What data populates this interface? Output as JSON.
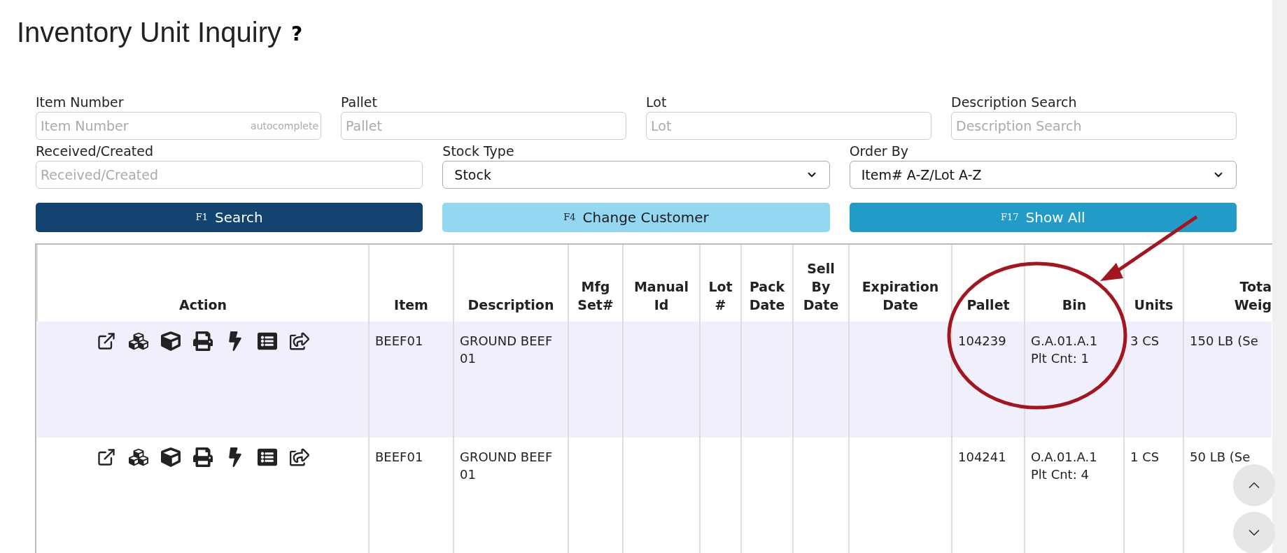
{
  "page": {
    "title": "Inventory Unit Inquiry",
    "help": "?"
  },
  "filter_rows": [
    [
      {
        "kind": "text",
        "label": "Item Number",
        "placeholder": "Item Number",
        "hint": "autocomplete"
      },
      {
        "kind": "text",
        "label": "Pallet",
        "placeholder": "Pallet"
      },
      {
        "kind": "text",
        "label": "Lot",
        "placeholder": "Lot"
      },
      {
        "kind": "text",
        "label": "Description Search",
        "placeholder": "Description Search"
      }
    ],
    [
      {
        "kind": "text",
        "label": "Received/Created",
        "placeholder": "Received/Created"
      },
      {
        "kind": "select",
        "label": "Stock Type",
        "value": "Stock"
      },
      {
        "kind": "select",
        "label": "Order By",
        "value": "Item# A-Z/Lot A-Z"
      }
    ]
  ],
  "buttons": [
    {
      "kind": "primary",
      "key": "F1",
      "label": "Search"
    },
    {
      "kind": "light",
      "key": "F4",
      "label": "Change Customer"
    },
    {
      "kind": "info",
      "key": "F17",
      "label": "Show All"
    }
  ],
  "table": {
    "columns": [
      "Action",
      "Item",
      "Description",
      "Mfg Set#",
      "Manual Id",
      "Lot #",
      "Pack Date",
      "Sell By Date",
      "Expiration Date",
      "Pallet",
      "Bin",
      "Units",
      "Tota\nWeig"
    ],
    "rows": [
      {
        "highlighted": true,
        "cells": [
          "",
          "BEEF01",
          "GROUND BEEF 01",
          "",
          "",
          "",
          "",
          "",
          "",
          "104239",
          "G.A.01.A.1\nPlt Cnt: 1",
          "3 CS",
          "150 LB (Se"
        ]
      },
      {
        "highlighted": false,
        "cells": [
          "",
          "BEEF01",
          "GROUND BEEF 01",
          "",
          "",
          "",
          "",
          "",
          "",
          "104241",
          "O.A.01.A.1\nPlt Cnt: 4",
          "1 CS",
          "50 LB (Se"
        ]
      }
    ]
  }
}
